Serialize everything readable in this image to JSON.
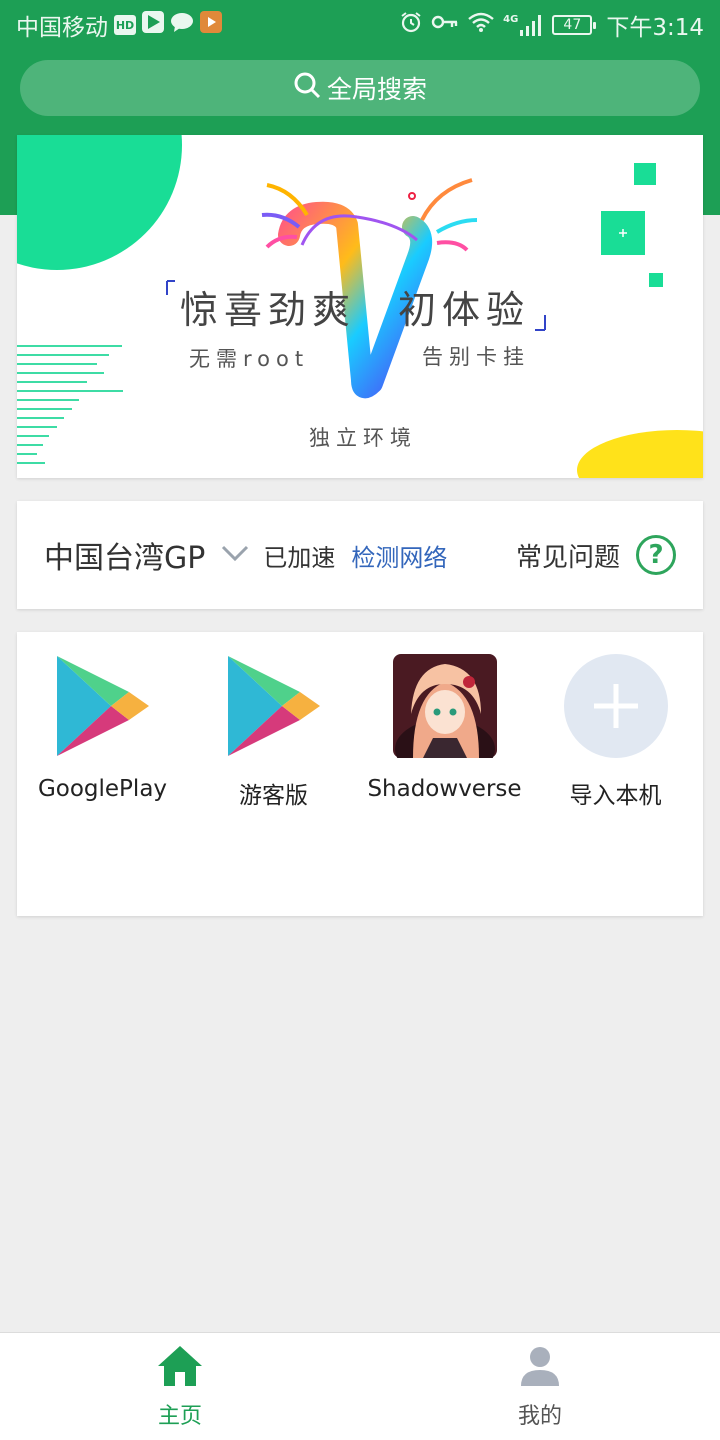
{
  "colors": {
    "primary_green": "#1d9f55",
    "link_blue": "#3366bb",
    "inactive_gray": "#a9b0bc",
    "background": "#eeeeee"
  },
  "status_bar": {
    "carrier": "中国移动",
    "hd_badge": "HD",
    "network_label": "4G",
    "battery": "47",
    "time": "下午3:14",
    "icons": [
      "alarm-icon",
      "key-icon",
      "wifi-icon",
      "signal-icon"
    ]
  },
  "search": {
    "label": "全局搜索",
    "icon": "search-icon"
  },
  "banner": {
    "headline_left": "惊喜劲爽",
    "headline_right": "初体验",
    "sub_left": "无需root",
    "sub_right": "告别卡挂",
    "sub_bottom": "独立环境"
  },
  "network": {
    "region": "中国台湾GP",
    "status": "已加速",
    "check_link": "检测网络",
    "faq": "常见问题",
    "faq_icon_glyph": "?"
  },
  "apps": [
    {
      "label": "GooglePlay",
      "icon": "google-play-icon"
    },
    {
      "label": "游客版",
      "icon": "google-play-icon"
    },
    {
      "label": "Shadowverse",
      "icon": "shadowverse-icon"
    },
    {
      "label": "导入本机",
      "icon": "plus-icon"
    }
  ],
  "bottom_nav": {
    "home": "主页",
    "mine": "我的"
  }
}
